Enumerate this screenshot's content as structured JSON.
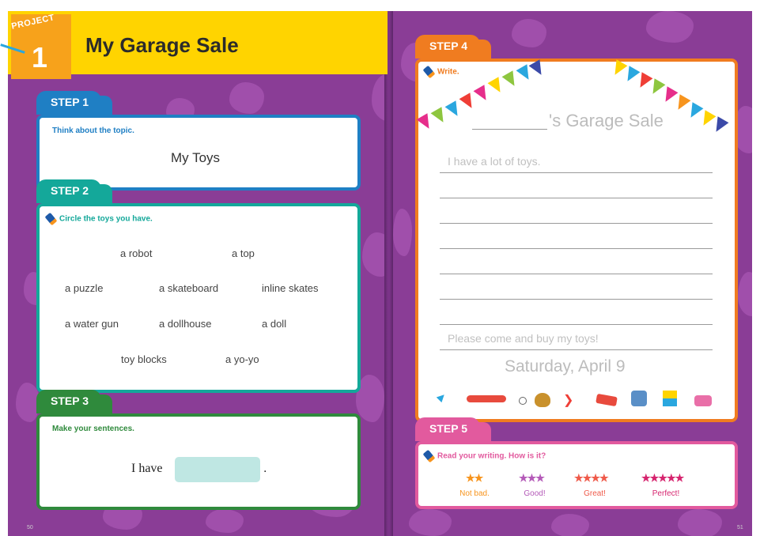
{
  "header": {
    "project_label": "PROJECT",
    "project_number": "1",
    "title": "My Garage Sale"
  },
  "step1": {
    "tab": "STEP 1",
    "instruction": "Think about the topic.",
    "topic": "My Toys"
  },
  "step2": {
    "tab": "STEP 2",
    "instruction": "Circle the toys you have.",
    "toys": [
      "a robot",
      "a top",
      "a puzzle",
      "a skateboard",
      "inline skates",
      "a water gun",
      "a dollhouse",
      "a doll",
      "toy blocks",
      "a yo-yo"
    ]
  },
  "step3": {
    "tab": "STEP 3",
    "instruction": "Make your sentences.",
    "sentence_start": "I have",
    "sentence_end": "."
  },
  "step4": {
    "tab": "STEP 4",
    "instruction": "Write.",
    "sale_title": "'s Garage Sale",
    "model_line_1": "I have a lot of toys.",
    "model_line_2": "Please come and buy my toys!",
    "date": "Saturday, April 9",
    "toy_icons": [
      "rocket-icon",
      "skateboard-icon",
      "top-icon",
      "glove-icon",
      "boomerang-icon",
      "car-icon",
      "robot-icon",
      "blocks-icon",
      "toy-car-icon"
    ]
  },
  "step5": {
    "tab": "STEP 5",
    "instruction": "Read your writing. How is it?",
    "ratings": [
      {
        "stars": "★★",
        "label": "Not bad.",
        "color": "#f7941d"
      },
      {
        "stars": "★★★",
        "label": "Good!",
        "color": "#b45ab8"
      },
      {
        "stars": "★★★★",
        "label": "Great!",
        "color": "#ef5a4a"
      },
      {
        "stars": "★★★★★",
        "label": "Perfect!",
        "color": "#d6246e"
      }
    ]
  },
  "page_numbers": {
    "left": "50",
    "right": "51"
  },
  "colors": {
    "background": "#8a3d96",
    "header": "#ffd400",
    "step1": "#1f7fc4",
    "step2": "#14a89a",
    "step3": "#2f8a3c",
    "step4": "#f07c20",
    "step5": "#e25a9e"
  }
}
